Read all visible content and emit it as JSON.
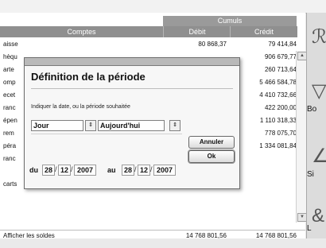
{
  "table": {
    "header_group": "Cumuls",
    "col_comptes": "Comptes",
    "col_debit": "Débit",
    "col_credit": "Crédit",
    "rows": [
      {
        "account": "aisse",
        "debit": "80 868,37",
        "credit": "79 414,84"
      },
      {
        "account": "hèqu",
        "debit": "",
        "credit": "906 679,77"
      },
      {
        "account": "arte",
        "debit": "",
        "credit": "260 713,64"
      },
      {
        "account": "omp",
        "debit": "",
        "credit": "5 466 584,78"
      },
      {
        "account": "ecet",
        "debit": "",
        "credit": "4 410 732,66"
      },
      {
        "account": "ranc",
        "debit": "",
        "credit": "422 200,00"
      },
      {
        "account": "épen",
        "debit": "",
        "credit": "1 110 318,33"
      },
      {
        "account": "rem",
        "debit": "",
        "credit": "778 075,70"
      },
      {
        "account": "péra",
        "debit": "",
        "credit": "1 334 081,84"
      },
      {
        "account": "ranc",
        "debit": "",
        "credit": ""
      },
      {
        "account": "",
        "debit": "",
        "credit": ""
      },
      {
        "account": "carts",
        "debit": "",
        "credit": ""
      }
    ],
    "footer_label": "Afficher les soldes",
    "footer_debit": "14 768 801,56",
    "footer_credit": "14 768 801,56"
  },
  "right_panel": {
    "labels": [
      "Bo",
      "Si",
      "L"
    ]
  },
  "dialog": {
    "title": "Définition de la période",
    "instruction": "Indiquer la date, ou la période souhaitée",
    "period_type": "Jour",
    "period_value": "Aujourd'hui",
    "cancel_label": "Annuler",
    "ok_label": "Ok",
    "from_label": "du",
    "to_label": "au",
    "from_date": {
      "day": "28",
      "month": "12",
      "year": "2007"
    },
    "to_date": {
      "day": "28",
      "month": "12",
      "year": "2007"
    }
  }
}
